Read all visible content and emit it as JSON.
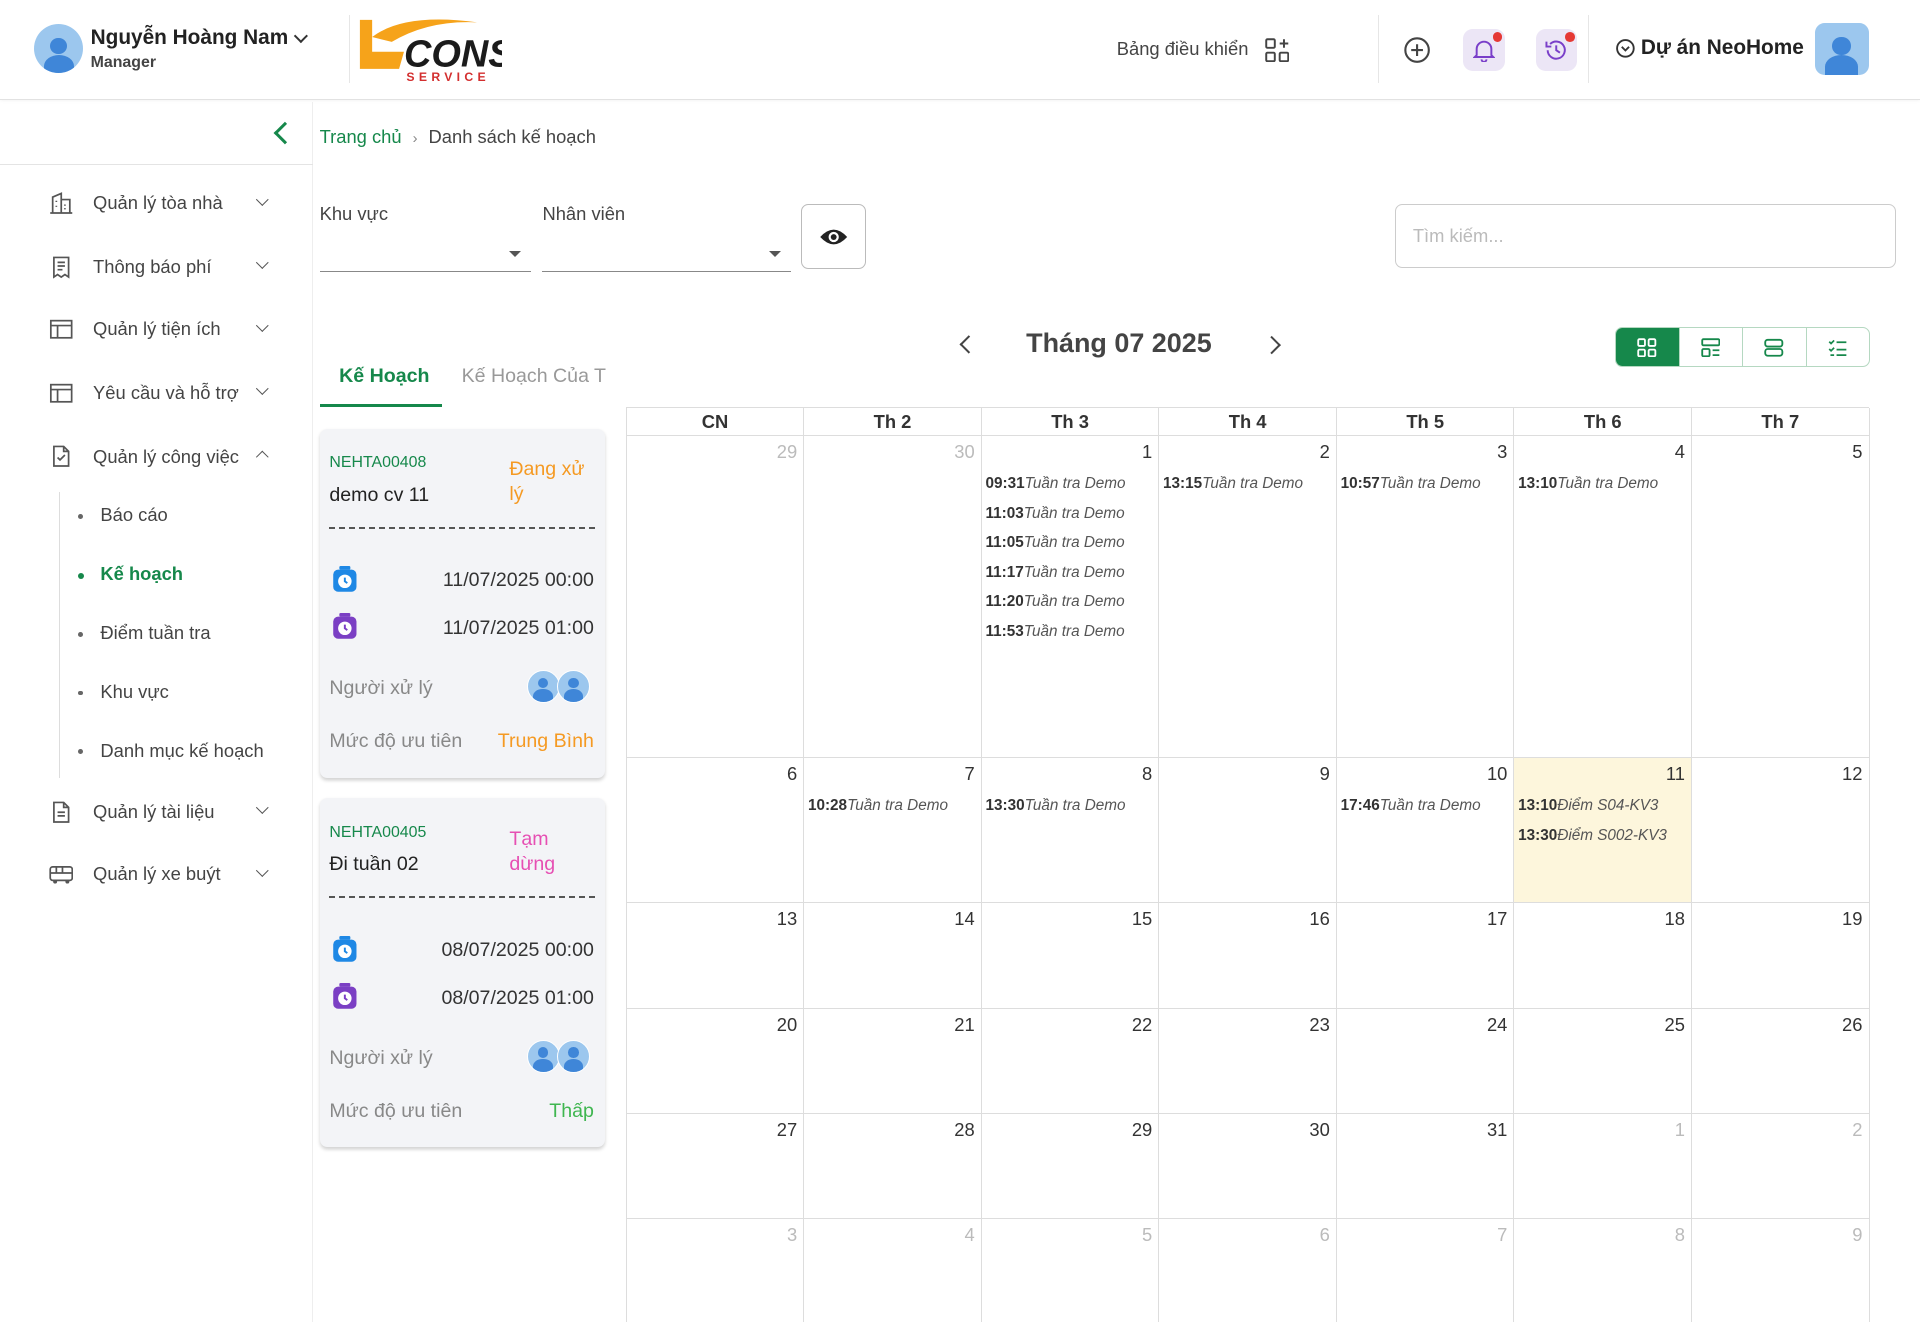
{
  "header": {
    "user_name": "Nguyễn Hoàng Nam",
    "user_role": "Manager",
    "logo_text_main": "CONS",
    "logo_text_sub": "SERVICE",
    "dashboard_label": "Bảng điều khiển",
    "project_label": "Dự án NeoHome",
    "colors": {
      "accent": "#16884b",
      "notification_dot": "#e53935",
      "icon_bg": "#ece6f6"
    }
  },
  "sidebar": {
    "items": [
      {
        "label": "Quản lý tòa nhà",
        "icon": "building-icon"
      },
      {
        "label": "Thông báo phí",
        "icon": "receipt-icon"
      },
      {
        "label": "Quản lý tiện ích",
        "icon": "table-icon"
      },
      {
        "label": "Yêu cầu và hỗ trợ",
        "icon": "table-icon"
      },
      {
        "label": "Quản lý công việc",
        "icon": "task-icon"
      },
      {
        "label": "Quản lý tài liệu",
        "icon": "document-icon"
      },
      {
        "label": "Quản lý xe buýt",
        "icon": "bus-icon"
      }
    ],
    "sub_items": [
      "Báo cáo",
      "Kế hoạch",
      "Điểm tuần tra",
      "Khu vực",
      "Danh mục kế hoạch"
    ],
    "active_sub": "Kế hoạch"
  },
  "breadcrumb": {
    "home": "Trang chủ",
    "sep": "›",
    "current": "Danh sách kế hoạch"
  },
  "filters": {
    "area_label": "Khu vực",
    "area_value": "",
    "staff_label": "Nhân viên",
    "staff_value": "",
    "search_placeholder": "Tìm kiếm..."
  },
  "tabs": [
    "Kế Hoạch",
    "Kế Hoạch Của Tôi"
  ],
  "cards": [
    {
      "code": "NEHTA00408",
      "title": "demo cv 11",
      "status": "Đang xử lý",
      "status_color": "#f59a23",
      "start": "11/07/2025 00:00",
      "end": "11/07/2025 01:00",
      "assignee_label": "Người xử lý",
      "priority_label": "Mức độ ưu tiên",
      "priority": "Trung Bình",
      "priority_color": "#f59a23"
    },
    {
      "code": "NEHTA00405",
      "title": "Đi tuần 02",
      "status": "Tạm dừng",
      "status_color": "#e64fb3",
      "start": "08/07/2025 00:00",
      "end": "08/07/2025 01:00",
      "assignee_label": "Người xử lý",
      "priority_label": "Mức độ ưu tiên",
      "priority": "Thấp",
      "priority_color": "#3fb650"
    }
  ],
  "calendar": {
    "title": "Tháng 07 2025",
    "weekdays": [
      "CN",
      "Th 2",
      "Th 3",
      "Th 4",
      "Th 5",
      "Th 6",
      "Th 7"
    ],
    "days": [
      29,
      30,
      1,
      2,
      3,
      4,
      5,
      6,
      7,
      8,
      9,
      10,
      11,
      12,
      13,
      14,
      15,
      16,
      17,
      18,
      19,
      20,
      21,
      22,
      23,
      24,
      25,
      26,
      27,
      28,
      29,
      30,
      31,
      1,
      2,
      3,
      4,
      5,
      6,
      7,
      8,
      9
    ],
    "events": {
      "2": [
        [
          "09:31",
          "Tuần tra Demo"
        ],
        [
          "11:03",
          "Tuần tra Demo"
        ],
        [
          "11:05",
          "Tuần tra Demo"
        ],
        [
          "11:17",
          "Tuần tra Demo"
        ],
        [
          "11:20",
          "Tuần tra Demo"
        ],
        [
          "11:53",
          "Tuần tra Demo"
        ]
      ],
      "3": [
        [
          "13:15",
          "Tuần tra Demo"
        ]
      ],
      "4": [
        [
          "10:57",
          "Tuần tra Demo"
        ]
      ],
      "5": [
        [
          "13:10",
          "Tuần tra Demo"
        ]
      ],
      "8": [
        [
          "10:28",
          "Tuần tra Demo"
        ]
      ],
      "9": [
        [
          "13:30",
          "Tuần tra Demo"
        ]
      ],
      "11": [
        [
          "17:46",
          "Tuần tra Demo"
        ]
      ],
      "12": [
        [
          "13:10",
          "Điểm S04-KV3"
        ],
        [
          "13:30",
          "Điểm S002-KV3"
        ]
      ]
    },
    "today_index": 12
  }
}
